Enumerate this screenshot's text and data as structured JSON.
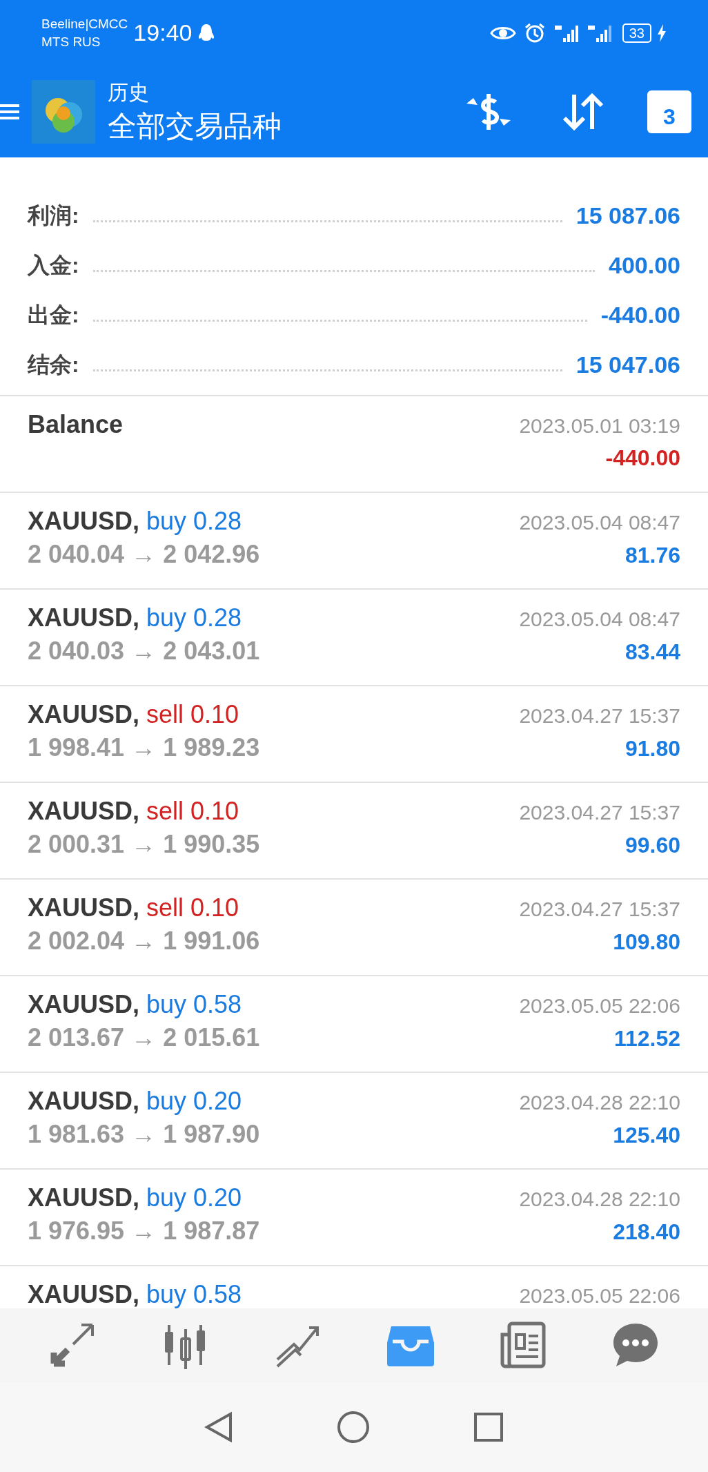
{
  "status_bar": {
    "carrier_1": "Beeline|CMCC",
    "carrier_2": "MTS RUS",
    "time": "19:40",
    "battery": "33"
  },
  "header": {
    "title": "历史",
    "subtitle": "全部交易品种",
    "calendar_day": "3"
  },
  "summary": [
    {
      "label": "利润:",
      "value": "15 087.06"
    },
    {
      "label": "入金:",
      "value": "400.00"
    },
    {
      "label": "出金:",
      "value": "-440.00"
    },
    {
      "label": "结余:",
      "value": "15 047.06"
    }
  ],
  "deals": [
    {
      "kind": "balance",
      "symbol": "Balance",
      "time": "2023.05.01 03:19",
      "profit": "-440.00",
      "negative": true
    },
    {
      "kind": "buy",
      "symbol": "XAUUSD,",
      "action": "buy 0.28",
      "prices": "2 040.04 → 2 042.96",
      "time": "2023.05.04 08:47",
      "profit": "81.76",
      "negative": false
    },
    {
      "kind": "buy",
      "symbol": "XAUUSD,",
      "action": "buy 0.28",
      "prices": "2 040.03 → 2 043.01",
      "time": "2023.05.04 08:47",
      "profit": "83.44",
      "negative": false
    },
    {
      "kind": "sell",
      "symbol": "XAUUSD,",
      "action": "sell 0.10",
      "prices": "1 998.41 → 1 989.23",
      "time": "2023.04.27 15:37",
      "profit": "91.80",
      "negative": false
    },
    {
      "kind": "sell",
      "symbol": "XAUUSD,",
      "action": "sell 0.10",
      "prices": "2 000.31 → 1 990.35",
      "time": "2023.04.27 15:37",
      "profit": "99.60",
      "negative": false
    },
    {
      "kind": "sell",
      "symbol": "XAUUSD,",
      "action": "sell 0.10",
      "prices": "2 002.04 → 1 991.06",
      "time": "2023.04.27 15:37",
      "profit": "109.80",
      "negative": false
    },
    {
      "kind": "buy",
      "symbol": "XAUUSD,",
      "action": "buy 0.58",
      "prices": "2 013.67 → 2 015.61",
      "time": "2023.05.05 22:06",
      "profit": "112.52",
      "negative": false
    },
    {
      "kind": "buy",
      "symbol": "XAUUSD,",
      "action": "buy 0.20",
      "prices": "1 981.63 → 1 987.90",
      "time": "2023.04.28 22:10",
      "profit": "125.40",
      "negative": false
    },
    {
      "kind": "buy",
      "symbol": "XAUUSD,",
      "action": "buy 0.20",
      "prices": "1 976.95 → 1 987.87",
      "time": "2023.04.28 22:10",
      "profit": "218.40",
      "negative": false
    },
    {
      "kind": "buy",
      "symbol": "XAUUSD,",
      "action": "buy 0.58",
      "time": "2023.05.05 22:06"
    }
  ],
  "bottom_nav": [
    {
      "kind": "trade",
      "selected": false
    },
    {
      "kind": "quotes",
      "selected": false
    },
    {
      "kind": "chart",
      "selected": false
    },
    {
      "kind": "history",
      "selected": true
    },
    {
      "kind": "news",
      "selected": false
    },
    {
      "kind": "chat",
      "selected": false
    }
  ]
}
